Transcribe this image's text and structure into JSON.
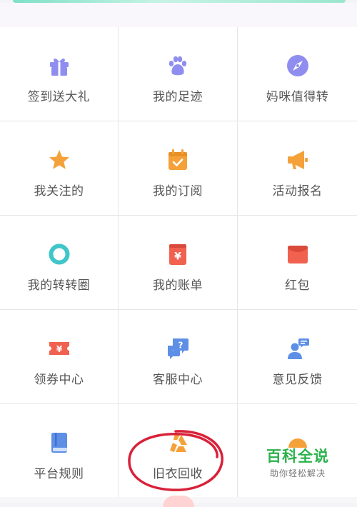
{
  "colors": {
    "purple": "#8f8ef0",
    "orange": "#f5a13a",
    "red": "#f0614f",
    "blue": "#5d8fe6",
    "teal": "#3fc6c9",
    "annotation_red": "#d9213a",
    "watermark_green": "#2bb24c"
  },
  "grid": {
    "items": [
      {
        "label": "签到送大礼",
        "icon": "gift-icon"
      },
      {
        "label": "我的足迹",
        "icon": "paw-icon"
      },
      {
        "label": "妈咪值得转",
        "icon": "compass-icon"
      },
      {
        "label": "我关注的",
        "icon": "star-icon"
      },
      {
        "label": "我的订阅",
        "icon": "calendar-check-icon"
      },
      {
        "label": "活动报名",
        "icon": "megaphone-icon"
      },
      {
        "label": "我的转转圈",
        "icon": "ring-icon"
      },
      {
        "label": "我的账单",
        "icon": "bill-icon"
      },
      {
        "label": "红包",
        "icon": "red-envelope-icon"
      },
      {
        "label": "领券中心",
        "icon": "coupon-icon"
      },
      {
        "label": "客服中心",
        "icon": "help-chat-icon"
      },
      {
        "label": "意见反馈",
        "icon": "feedback-user-icon"
      },
      {
        "label": "平台规则",
        "icon": "book-icon"
      },
      {
        "label": "旧衣回收",
        "icon": "recycle-icon"
      },
      {
        "label": "",
        "icon": "sunrise-icon"
      }
    ]
  },
  "watermark": {
    "title": "百科全说",
    "subtitle": "助你轻松解决"
  }
}
